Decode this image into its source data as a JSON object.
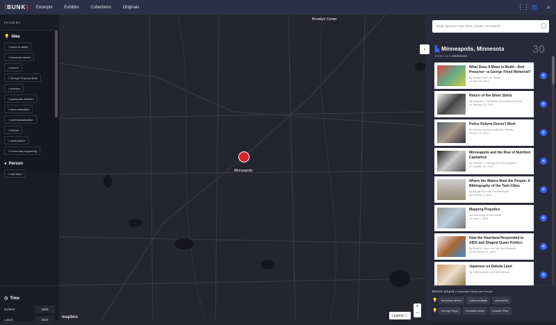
{
  "nav": {
    "logo": "BUNK",
    "links": [
      "Excerpts",
      "Exhibits",
      "Collections",
      "Originals"
    ],
    "icons": [
      "grid-icon",
      "map-icon",
      "search-icon"
    ]
  },
  "sidebar": {
    "filter_label": "FILTER BY:",
    "idea_label": "Idea",
    "idea_tags": [
      "police brutality",
      "structural racism",
      "protest",
      "George Floyd protests",
      "activism",
      "grassroots activism",
      "memorialization",
      "professionalization",
      "Dakota",
      "racial justice",
      "community organizing"
    ],
    "person_label": "Person",
    "person_tags": [
      "Karl Marx"
    ],
    "time_label": "Time",
    "earliest_label": "Earliest",
    "earliest": "1820",
    "latest_label": "Latest",
    "latest": "2026"
  },
  "map": {
    "labels": {
      "brooklyn": "Brooklyn Center",
      "minneapolis": "Minneapolis"
    },
    "attribution": "mapbox",
    "legend": "Legend",
    "zoom_in": "+",
    "zoom_out": "−"
  },
  "panel": {
    "search_placeholder": "Begin typing to map ideas, people, and places",
    "title": "Minneapolis, Minnesota",
    "zoom_out_prefix": "Zoom out to",
    "zoom_out_target": "Minnesota",
    "count": "30",
    "cards": [
      {
        "title": "What Does It Mean to Build—And Preserve—a George Floyd Memorial?",
        "by": "By Ashley Tyner via Vogue",
        "date": "on April 26, 2021"
      },
      {
        "title": "Return of the Silver Shirts",
        "by": "By Samuel G. Freedman via Liberal Currents",
        "date": "on January 12, 2026"
      },
      {
        "title": "Police Reform Doesn't Work",
        "by": "By Michael Meines via Boston Review",
        "date": "on April 23, 2021"
      },
      {
        "title": "Minneapolis and the Rise of Nutrition Capitalism",
        "by": "By Michael J. Lansing via The Metropole",
        "date": "on October 20, 2020"
      },
      {
        "title": "Where the Waters Meet the People: A Bibliography of the Twin Cities",
        "by": "By Avigail Oren via The Metropole",
        "date": "on October 2, 2020"
      },
      {
        "title": "Mapping Prejudice",
        "by": "Via University of Minnesota",
        "date": "on June 1, 2016"
      },
      {
        "title": "How the Heartland Responded to AIDS and Shaped Queer Politics",
        "by": "By Scott W. Stern via The New Republic",
        "date": "on November 11, 2025"
      },
      {
        "title": "Japanese on Dakota Land",
        "by": "By Patti Kameya via Patti Kameya",
        "date": ""
      }
    ],
    "begin_label": "BEGIN AGAIN",
    "begin_sub": "/ Associated Ideas and People",
    "ideas": [
      "structural racism",
      "police brutality",
      "community"
    ],
    "people": [
      "George Floyd",
      "Jeanelle Austin",
      "Zebulon Pike"
    ]
  }
}
